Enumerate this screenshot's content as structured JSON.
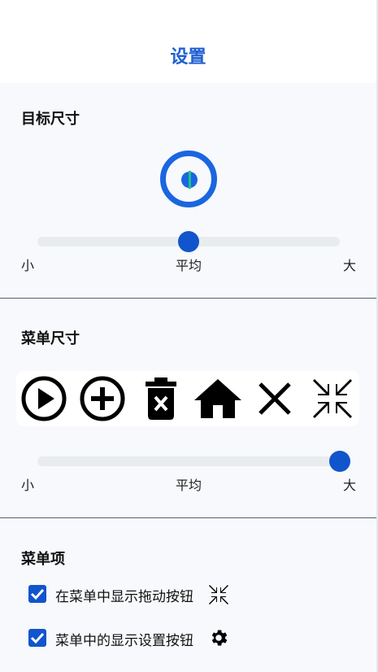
{
  "header": {
    "title": "设置"
  },
  "target_size": {
    "title": "目标尺寸",
    "slider": {
      "value": 0.5,
      "min_label": "小",
      "mid_label": "平均",
      "max_label": "大"
    }
  },
  "menu_size": {
    "title": "菜单尺寸",
    "icons": [
      "play-icon",
      "add-icon",
      "delete-icon",
      "home-icon",
      "close-icon",
      "collapse-icon"
    ],
    "slider": {
      "value": 1.0,
      "min_label": "小",
      "mid_label": "平均",
      "max_label": "大"
    }
  },
  "menu_items": {
    "title": "菜单项",
    "options": [
      {
        "label": "在菜单中显示拖动按钮",
        "checked": true,
        "icon": "collapse-icon"
      },
      {
        "label": "菜单中的显示设置按钮",
        "checked": true,
        "icon": "gear-icon"
      }
    ]
  },
  "colors": {
    "accent": "#1155cc",
    "title": "#1f5fd1",
    "target_line": "#21c08b"
  }
}
